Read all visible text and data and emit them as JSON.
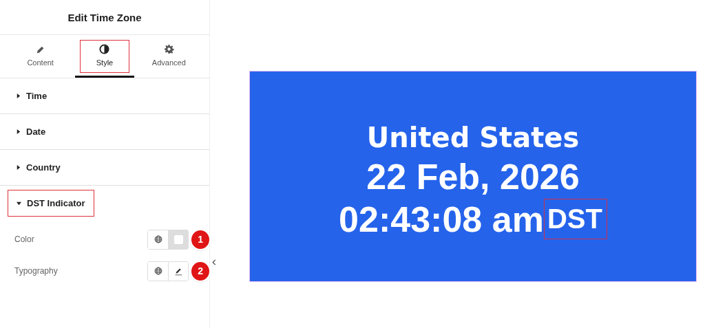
{
  "panel": {
    "title": "Edit Time Zone",
    "tabs": [
      {
        "label": "Content",
        "selected": false,
        "highlighted": false
      },
      {
        "label": "Style",
        "selected": true,
        "highlighted": true
      },
      {
        "label": "Advanced",
        "selected": false,
        "highlighted": false
      }
    ],
    "sections": [
      {
        "label": "Time",
        "expanded": false,
        "highlighted": false
      },
      {
        "label": "Date",
        "expanded": false,
        "highlighted": false
      },
      {
        "label": "Country",
        "expanded": false,
        "highlighted": false
      },
      {
        "label": "DST Indicator",
        "expanded": true,
        "highlighted": true
      }
    ],
    "controls": [
      {
        "label": "Color",
        "kind": "color",
        "badge": "1"
      },
      {
        "label": "Typography",
        "kind": "typography",
        "badge": "2"
      }
    ]
  },
  "preview": {
    "country": "United States",
    "date": "22 Feb, 2026",
    "time": "02:43:08 am",
    "dst": "DST",
    "dst_highlighted": true
  }
}
